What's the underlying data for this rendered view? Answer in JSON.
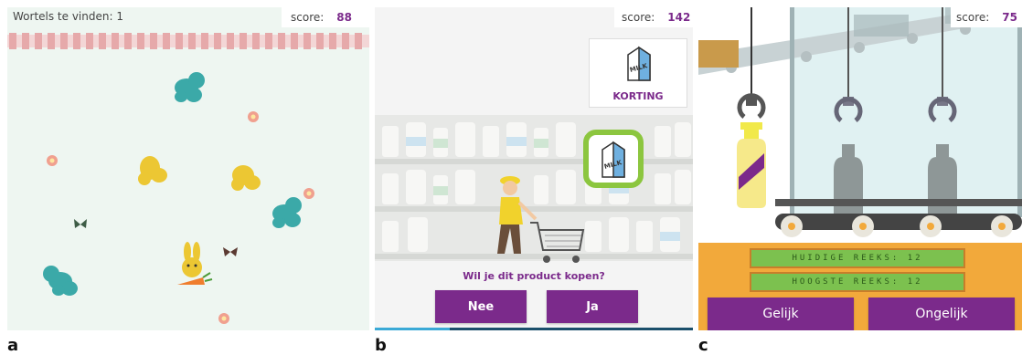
{
  "panel_a": {
    "letter": "a",
    "counter_text": "Wortels te vinden: 1",
    "score_label": "score:",
    "score_value": "88",
    "icons": [
      "butterfly-icon",
      "flower-icon",
      "rabbit-icon",
      "carrot-icon"
    ]
  },
  "panel_b": {
    "letter": "b",
    "score_label": "score:",
    "score_value": "142",
    "product_label": "KORTING",
    "carton_text": "MILK",
    "question": "Wil je dit product kopen?",
    "no_label": "Nee",
    "yes_label": "Ja",
    "icons": [
      "milk-carton-icon",
      "shopper-icon",
      "shopping-cart-icon"
    ]
  },
  "panel_c": {
    "letter": "c",
    "score_label": "score:",
    "score_value": "75",
    "current_streak": "HUIDIGE REEKS: 12",
    "best_streak": "HOOGSTE REEKS: 12",
    "equal_label": "Gelijk",
    "unequal_label": "Ongelijk",
    "icons": [
      "robot-claw-icon",
      "bottle-icon",
      "conveyor-belt-icon"
    ]
  },
  "colors": {
    "accent": "#7b2a8b",
    "panel_a_bg": "#eef6f1",
    "green": "#7cc14f",
    "orange": "#f2a93b"
  }
}
